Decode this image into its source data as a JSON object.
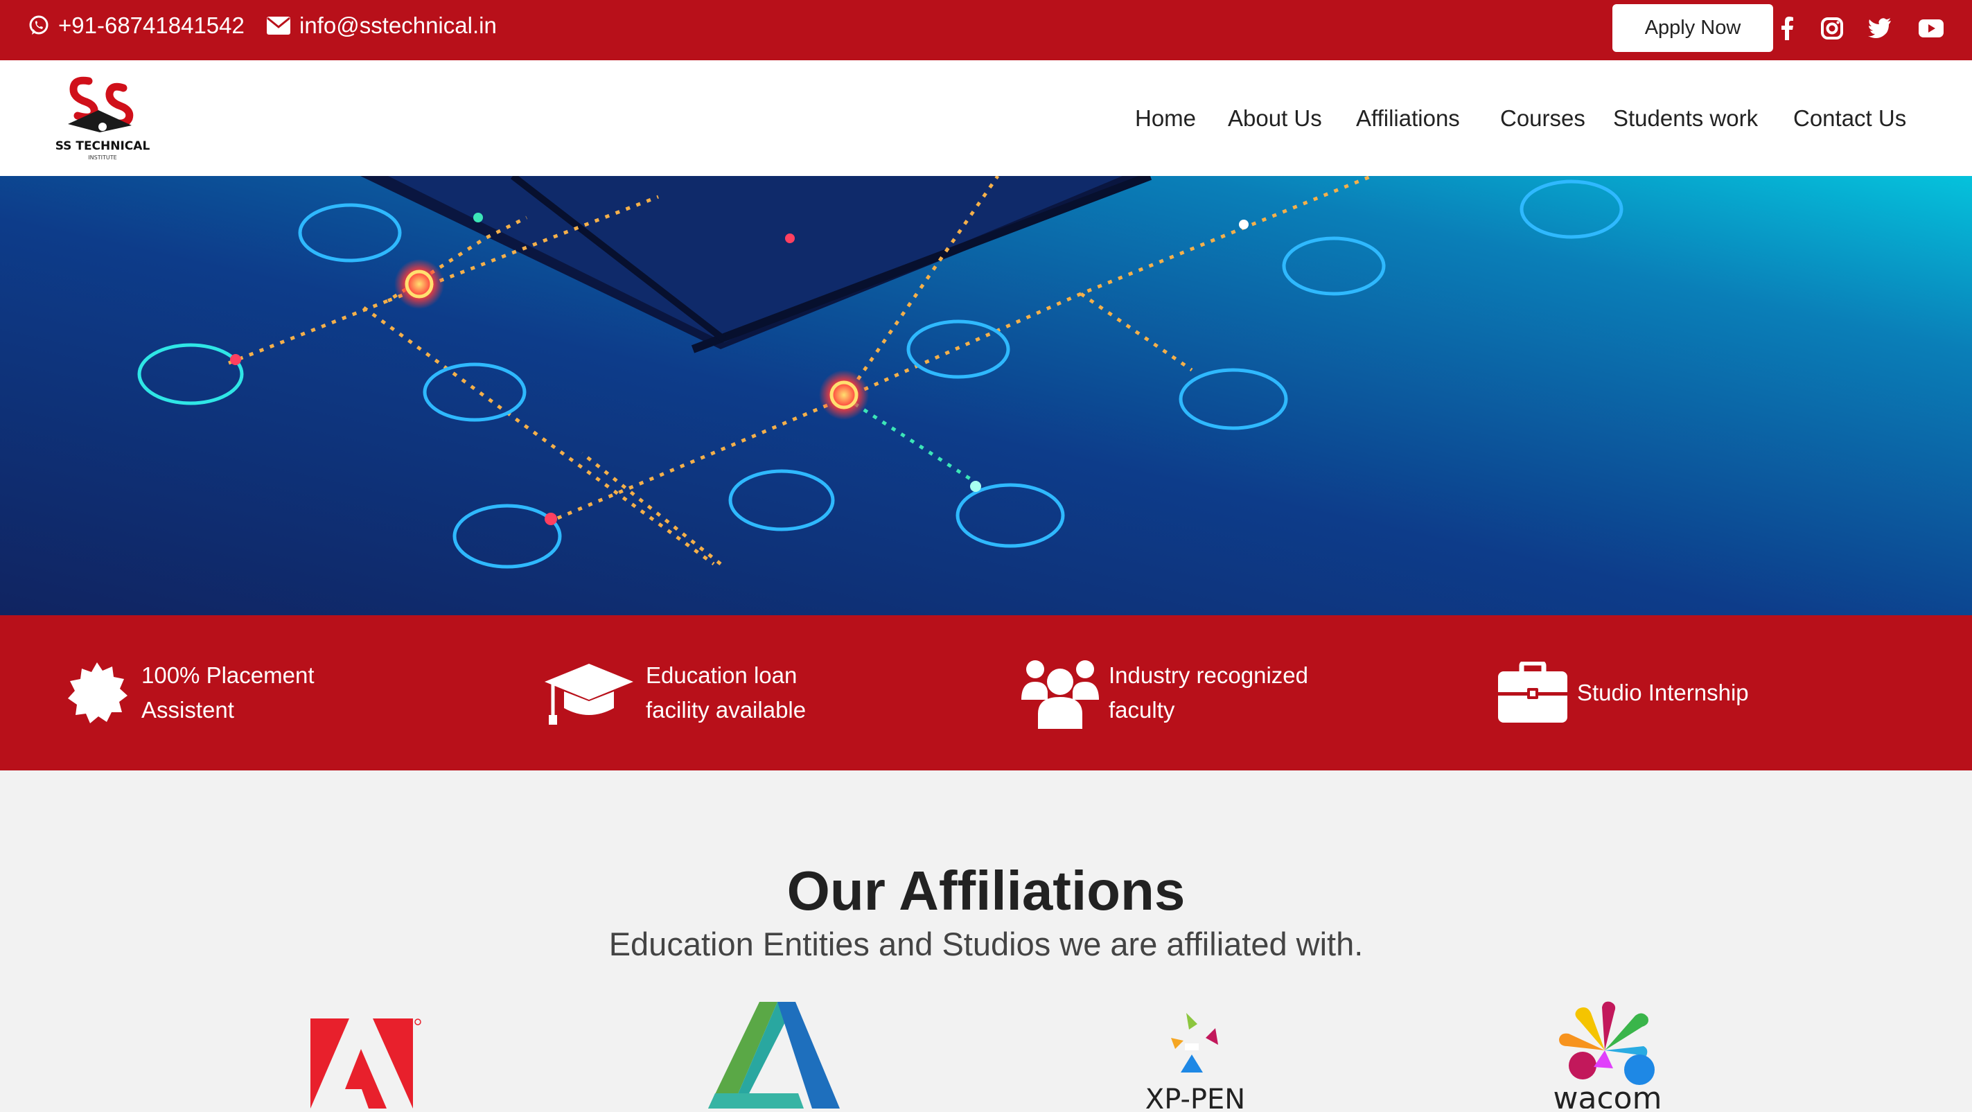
{
  "topbar": {
    "phone": "+91-68741841542",
    "email": "info@sstechnical.in",
    "apply_label": "Apply Now",
    "social_icons": [
      "facebook-icon",
      "instagram-icon",
      "twitter-icon",
      "youtube-icon"
    ],
    "bg_color": "#b8101a"
  },
  "logo": {
    "line1": "SS TECHNICAL",
    "line2": "INSTITUTE"
  },
  "nav": {
    "items": [
      {
        "label": "Home"
      },
      {
        "label": "About Us"
      },
      {
        "label": "Affiliations"
      },
      {
        "label": "Courses"
      },
      {
        "label": "Students work"
      },
      {
        "label": "Contact Us"
      }
    ]
  },
  "features": [
    {
      "icon": "badge-icon",
      "label": "100% Placement\nAssistent"
    },
    {
      "icon": "graduation-cap-icon",
      "label": "Education loan\nfacility available"
    },
    {
      "icon": "users-icon",
      "label": "Industry recognized\nfaculty"
    },
    {
      "icon": "briefcase-icon",
      "label": "Studio Internship"
    }
  ],
  "affiliations": {
    "title": "Our Affiliations",
    "subtitle": "Education Entities and Studios we are affiliated with.",
    "partners": [
      {
        "icon": "adobe-logo-icon"
      },
      {
        "icon": "autodesk-logo-icon"
      },
      {
        "icon": "xp-pen-logo-icon",
        "text": "XP-PEN"
      },
      {
        "icon": "wacom-logo-icon",
        "text": "wacom"
      }
    ]
  }
}
